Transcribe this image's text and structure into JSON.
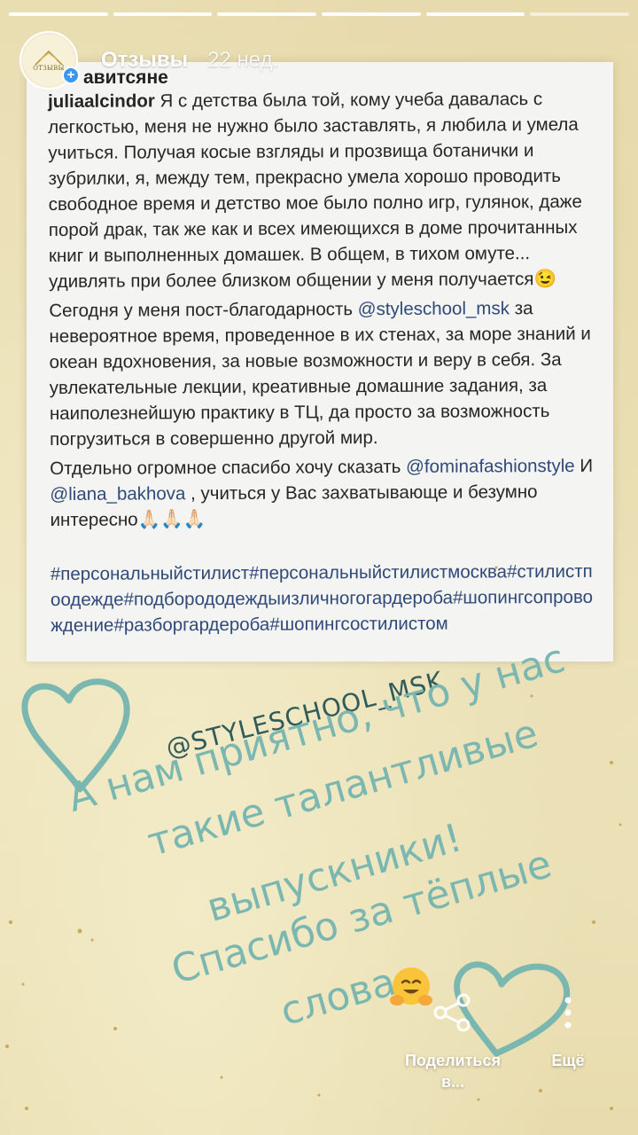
{
  "story": {
    "progress_segments": 6,
    "title": "Отзывы",
    "time": "22 нед.",
    "avatar_label": "ОТЗЫВЫ",
    "add_badge": "+"
  },
  "card": {
    "top_cut": "авитсяне",
    "username": "juliaalcindor",
    "p1": " Я с детства была той, кому учеба давалась с легкостью, меня не нужно было заставлять, я любила и умела учиться. Получая косые взгляды и прозвища ботанички и зубрилки, я, между тем, прекрасно умела хорошо проводить свободное время и детство мое было полно игр, гулянок, даже порой драк, так же как и всех имеющихся в доме прочитанных книг и выполненных домашек. В общем, в тихом омуте... удивлять при более близком общении у меня получается😉",
    "p2_before": "Сегодня у меня пост-благодарность ",
    "p2_mention": "@styleschool_msk",
    "p2_after": " за невероятное время, проведенное в их стенах, за море знаний и океан вдохновения, за новые возможности и веру в себя. За увлекательные лекции, креативные домашние задания, за наиполезнейшую практику в ТЦ, да просто за возможность погрузиться в совершенно другой мир.",
    "p3_before": "Отдельно огромное спасибо хочу сказать ",
    "p3_mention1": "@fominafashionstyle",
    "p3_mid": " И ",
    "p3_mention2": "@liana_bakhova",
    "p3_after": " , учиться у Вас захватывающе и безумно интересно🙏🏻🙏🏻🙏🏻",
    "hashtags": "#персональныйстилист#персональныйстилистмосква#стилистпоодежде#подборододеждыизличногогардероба#шопингсопровождение#разборгардероба#шопингсостилистом"
  },
  "overlay": {
    "mention_sticker": "@STYLESCHOOL_MSK",
    "line1": "А нам приятно, что у нас",
    "line2": "такие талантливые",
    "line3": "выпускники!",
    "line4": "Спасибо за тёплые",
    "line5": "слова",
    "accent_color": "#7bb7b1"
  },
  "actions": {
    "share_icon": "share-icon",
    "share_label": "Поделиться в...",
    "more_icon": "more-vertical-icon",
    "more_label": "Ещё"
  }
}
